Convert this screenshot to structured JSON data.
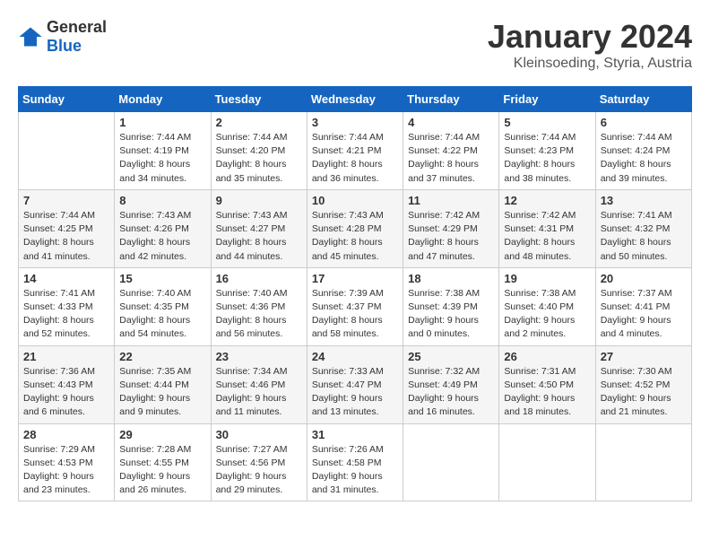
{
  "logo": {
    "general": "General",
    "blue": "Blue"
  },
  "header": {
    "month_year": "January 2024",
    "location": "Kleinsoeding, Styria, Austria"
  },
  "weekdays": [
    "Sunday",
    "Monday",
    "Tuesday",
    "Wednesday",
    "Thursday",
    "Friday",
    "Saturday"
  ],
  "weeks": [
    [
      {
        "day": "",
        "sunrise": "",
        "sunset": "",
        "daylight": ""
      },
      {
        "day": "1",
        "sunrise": "Sunrise: 7:44 AM",
        "sunset": "Sunset: 4:19 PM",
        "daylight": "Daylight: 8 hours and 34 minutes."
      },
      {
        "day": "2",
        "sunrise": "Sunrise: 7:44 AM",
        "sunset": "Sunset: 4:20 PM",
        "daylight": "Daylight: 8 hours and 35 minutes."
      },
      {
        "day": "3",
        "sunrise": "Sunrise: 7:44 AM",
        "sunset": "Sunset: 4:21 PM",
        "daylight": "Daylight: 8 hours and 36 minutes."
      },
      {
        "day": "4",
        "sunrise": "Sunrise: 7:44 AM",
        "sunset": "Sunset: 4:22 PM",
        "daylight": "Daylight: 8 hours and 37 minutes."
      },
      {
        "day": "5",
        "sunrise": "Sunrise: 7:44 AM",
        "sunset": "Sunset: 4:23 PM",
        "daylight": "Daylight: 8 hours and 38 minutes."
      },
      {
        "day": "6",
        "sunrise": "Sunrise: 7:44 AM",
        "sunset": "Sunset: 4:24 PM",
        "daylight": "Daylight: 8 hours and 39 minutes."
      }
    ],
    [
      {
        "day": "7",
        "sunrise": "Sunrise: 7:44 AM",
        "sunset": "Sunset: 4:25 PM",
        "daylight": "Daylight: 8 hours and 41 minutes."
      },
      {
        "day": "8",
        "sunrise": "Sunrise: 7:43 AM",
        "sunset": "Sunset: 4:26 PM",
        "daylight": "Daylight: 8 hours and 42 minutes."
      },
      {
        "day": "9",
        "sunrise": "Sunrise: 7:43 AM",
        "sunset": "Sunset: 4:27 PM",
        "daylight": "Daylight: 8 hours and 44 minutes."
      },
      {
        "day": "10",
        "sunrise": "Sunrise: 7:43 AM",
        "sunset": "Sunset: 4:28 PM",
        "daylight": "Daylight: 8 hours and 45 minutes."
      },
      {
        "day": "11",
        "sunrise": "Sunrise: 7:42 AM",
        "sunset": "Sunset: 4:29 PM",
        "daylight": "Daylight: 8 hours and 47 minutes."
      },
      {
        "day": "12",
        "sunrise": "Sunrise: 7:42 AM",
        "sunset": "Sunset: 4:31 PM",
        "daylight": "Daylight: 8 hours and 48 minutes."
      },
      {
        "day": "13",
        "sunrise": "Sunrise: 7:41 AM",
        "sunset": "Sunset: 4:32 PM",
        "daylight": "Daylight: 8 hours and 50 minutes."
      }
    ],
    [
      {
        "day": "14",
        "sunrise": "Sunrise: 7:41 AM",
        "sunset": "Sunset: 4:33 PM",
        "daylight": "Daylight: 8 hours and 52 minutes."
      },
      {
        "day": "15",
        "sunrise": "Sunrise: 7:40 AM",
        "sunset": "Sunset: 4:35 PM",
        "daylight": "Daylight: 8 hours and 54 minutes."
      },
      {
        "day": "16",
        "sunrise": "Sunrise: 7:40 AM",
        "sunset": "Sunset: 4:36 PM",
        "daylight": "Daylight: 8 hours and 56 minutes."
      },
      {
        "day": "17",
        "sunrise": "Sunrise: 7:39 AM",
        "sunset": "Sunset: 4:37 PM",
        "daylight": "Daylight: 8 hours and 58 minutes."
      },
      {
        "day": "18",
        "sunrise": "Sunrise: 7:38 AM",
        "sunset": "Sunset: 4:39 PM",
        "daylight": "Daylight: 9 hours and 0 minutes."
      },
      {
        "day": "19",
        "sunrise": "Sunrise: 7:38 AM",
        "sunset": "Sunset: 4:40 PM",
        "daylight": "Daylight: 9 hours and 2 minutes."
      },
      {
        "day": "20",
        "sunrise": "Sunrise: 7:37 AM",
        "sunset": "Sunset: 4:41 PM",
        "daylight": "Daylight: 9 hours and 4 minutes."
      }
    ],
    [
      {
        "day": "21",
        "sunrise": "Sunrise: 7:36 AM",
        "sunset": "Sunset: 4:43 PM",
        "daylight": "Daylight: 9 hours and 6 minutes."
      },
      {
        "day": "22",
        "sunrise": "Sunrise: 7:35 AM",
        "sunset": "Sunset: 4:44 PM",
        "daylight": "Daylight: 9 hours and 9 minutes."
      },
      {
        "day": "23",
        "sunrise": "Sunrise: 7:34 AM",
        "sunset": "Sunset: 4:46 PM",
        "daylight": "Daylight: 9 hours and 11 minutes."
      },
      {
        "day": "24",
        "sunrise": "Sunrise: 7:33 AM",
        "sunset": "Sunset: 4:47 PM",
        "daylight": "Daylight: 9 hours and 13 minutes."
      },
      {
        "day": "25",
        "sunrise": "Sunrise: 7:32 AM",
        "sunset": "Sunset: 4:49 PM",
        "daylight": "Daylight: 9 hours and 16 minutes."
      },
      {
        "day": "26",
        "sunrise": "Sunrise: 7:31 AM",
        "sunset": "Sunset: 4:50 PM",
        "daylight": "Daylight: 9 hours and 18 minutes."
      },
      {
        "day": "27",
        "sunrise": "Sunrise: 7:30 AM",
        "sunset": "Sunset: 4:52 PM",
        "daylight": "Daylight: 9 hours and 21 minutes."
      }
    ],
    [
      {
        "day": "28",
        "sunrise": "Sunrise: 7:29 AM",
        "sunset": "Sunset: 4:53 PM",
        "daylight": "Daylight: 9 hours and 23 minutes."
      },
      {
        "day": "29",
        "sunrise": "Sunrise: 7:28 AM",
        "sunset": "Sunset: 4:55 PM",
        "daylight": "Daylight: 9 hours and 26 minutes."
      },
      {
        "day": "30",
        "sunrise": "Sunrise: 7:27 AM",
        "sunset": "Sunset: 4:56 PM",
        "daylight": "Daylight: 9 hours and 29 minutes."
      },
      {
        "day": "31",
        "sunrise": "Sunrise: 7:26 AM",
        "sunset": "Sunset: 4:58 PM",
        "daylight": "Daylight: 9 hours and 31 minutes."
      },
      {
        "day": "",
        "sunrise": "",
        "sunset": "",
        "daylight": ""
      },
      {
        "day": "",
        "sunrise": "",
        "sunset": "",
        "daylight": ""
      },
      {
        "day": "",
        "sunrise": "",
        "sunset": "",
        "daylight": ""
      }
    ]
  ]
}
